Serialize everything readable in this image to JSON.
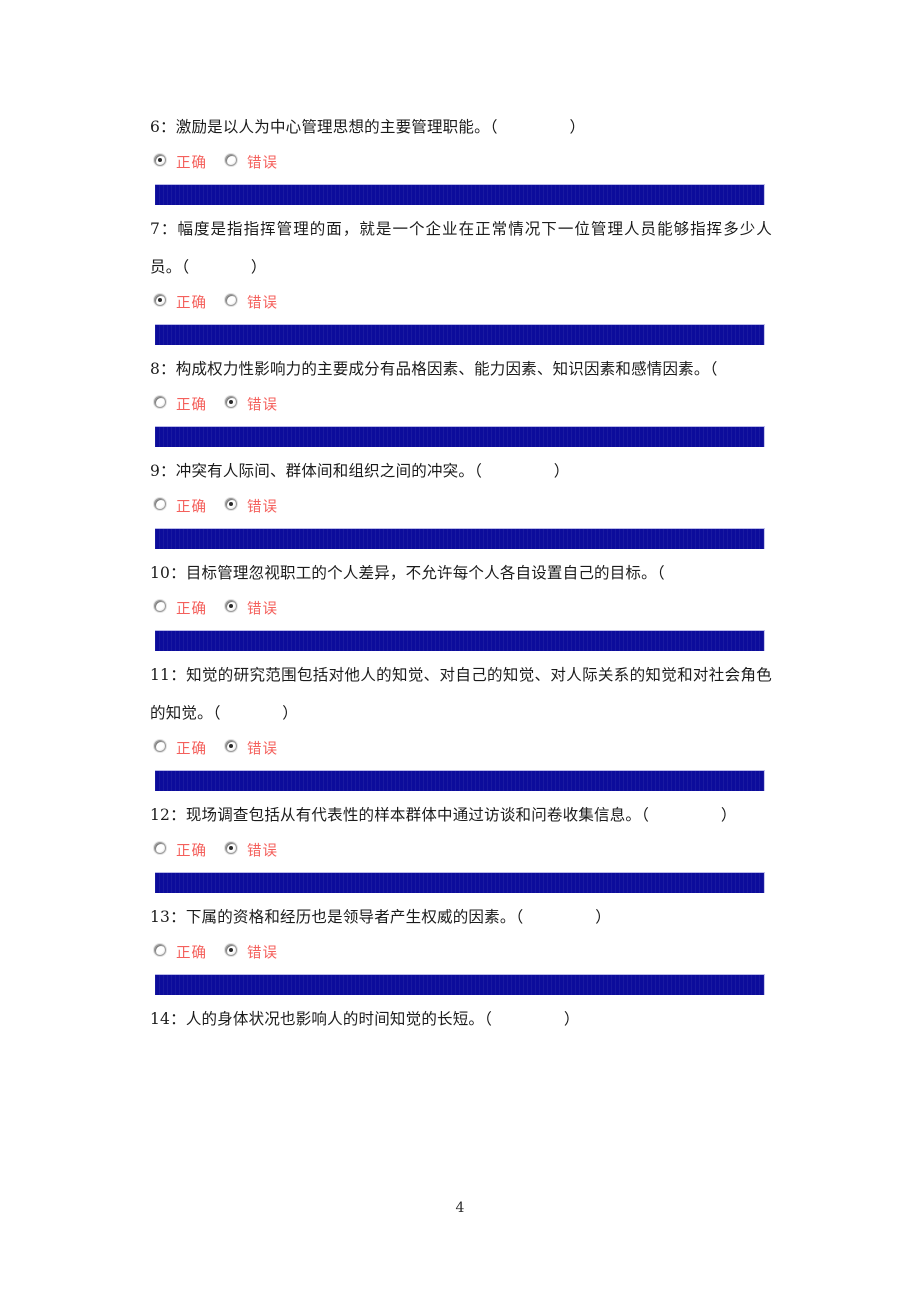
{
  "document": {
    "page_number": "4",
    "option_true_label": "正确",
    "option_false_label": "错误",
    "colors": {
      "option_text": "#f4605c",
      "selection_bar": "#0c0c9b",
      "body_text": "#1b1b1b"
    }
  },
  "questions": [
    {
      "number": "6",
      "text": "6：激励是以人为中心管理思想的主要管理职能。（              ）",
      "options": [
        {
          "label": "正确",
          "selected": true
        },
        {
          "label": "错误",
          "selected": false
        }
      ],
      "has_selection_bar": true
    },
    {
      "number": "7",
      "text": "7：幅度是指指挥管理的面，就是一个企业在正常情况下一位管理人员能够指挥多少人员。（            ）",
      "options": [
        {
          "label": "正确",
          "selected": true
        },
        {
          "label": "错误",
          "selected": false
        }
      ],
      "has_selection_bar": true
    },
    {
      "number": "8",
      "text": "8：构成权力性影响力的主要成分有品格因素、能力因素、知识因素和感情因素。（",
      "options": [
        {
          "label": "正确",
          "selected": false
        },
        {
          "label": "错误",
          "selected": true
        }
      ],
      "has_selection_bar": true
    },
    {
      "number": "9",
      "text": "9：冲突有人际间、群体间和组织之间的冲突。（              ）",
      "options": [
        {
          "label": "正确",
          "selected": false
        },
        {
          "label": "错误",
          "selected": true
        }
      ],
      "has_selection_bar": true
    },
    {
      "number": "10",
      "text": "10：目标管理忽视职工的个人差异，不允许每个人各自设置自己的目标。（",
      "options": [
        {
          "label": "正确",
          "selected": false
        },
        {
          "label": "错误",
          "selected": true
        }
      ],
      "has_selection_bar": true
    },
    {
      "number": "11",
      "text": "11：知觉的研究范围包括对他人的知觉、对自己的知觉、对人际关系的知觉和对社会角色的知觉。（            ）",
      "options": [
        {
          "label": "正确",
          "selected": false
        },
        {
          "label": "错误",
          "selected": true
        }
      ],
      "has_selection_bar": true
    },
    {
      "number": "12",
      "text": "12：现场调查包括从有代表性的样本群体中通过访谈和问卷收集信息。（              ）",
      "options": [
        {
          "label": "正确",
          "selected": false
        },
        {
          "label": "错误",
          "selected": true
        }
      ],
      "has_selection_bar": true
    },
    {
      "number": "13",
      "text": "13：下属的资格和经历也是领导者产生权威的因素。（              ）",
      "options": [
        {
          "label": "正确",
          "selected": false
        },
        {
          "label": "错误",
          "selected": true
        }
      ],
      "has_selection_bar": true
    },
    {
      "number": "14",
      "text": "14：人的身体状况也影响人的时间知觉的长短。（              ）",
      "options": [],
      "has_selection_bar": false
    }
  ]
}
